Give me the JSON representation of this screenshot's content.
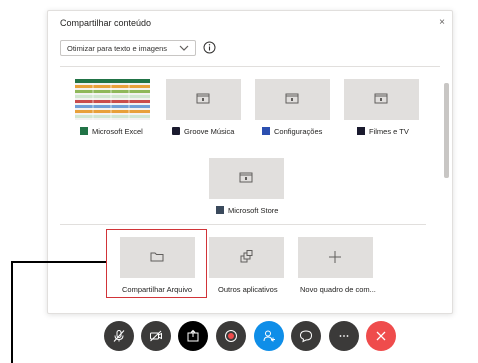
{
  "dialog": {
    "title": "Compartilhar conteúdo",
    "close_glyph": "×",
    "optimize_select": {
      "selected": "Otimizar para texto e imagens"
    }
  },
  "apps": [
    {
      "label": "Microsoft Excel",
      "icon": "excel-icon"
    },
    {
      "label": "Groove Música",
      "icon": "groove-music-icon"
    },
    {
      "label": "Configurações",
      "icon": "settings-icon"
    },
    {
      "label": "Filmes e TV",
      "icon": "movies-tv-icon"
    },
    {
      "label": "Microsoft Store",
      "icon": "store-icon"
    }
  ],
  "actions": [
    {
      "label": "Compartilhar Arquivo",
      "icon": "folder-icon"
    },
    {
      "label": "Outros aplicativos",
      "icon": "apps-icon"
    },
    {
      "label": "Novo quadro de com...",
      "icon": "plus-icon"
    }
  ],
  "controls": [
    {
      "name": "mute-button",
      "icon": "mic-off-icon"
    },
    {
      "name": "video-button",
      "icon": "video-off-icon"
    },
    {
      "name": "share-button",
      "icon": "share-icon"
    },
    {
      "name": "record-button",
      "icon": "record-icon"
    },
    {
      "name": "participants-button",
      "icon": "participants-icon"
    },
    {
      "name": "chat-button",
      "icon": "chat-icon"
    },
    {
      "name": "more-button",
      "icon": "more-icon"
    },
    {
      "name": "leave-button",
      "icon": "close-icon"
    }
  ],
  "colors": {
    "highlight": "#d13438",
    "tile": "#e1dfdd",
    "control": "#3b3a39",
    "share_active": "#000000",
    "participants": "#0f8ee8",
    "leave": "#ef4c4c"
  }
}
